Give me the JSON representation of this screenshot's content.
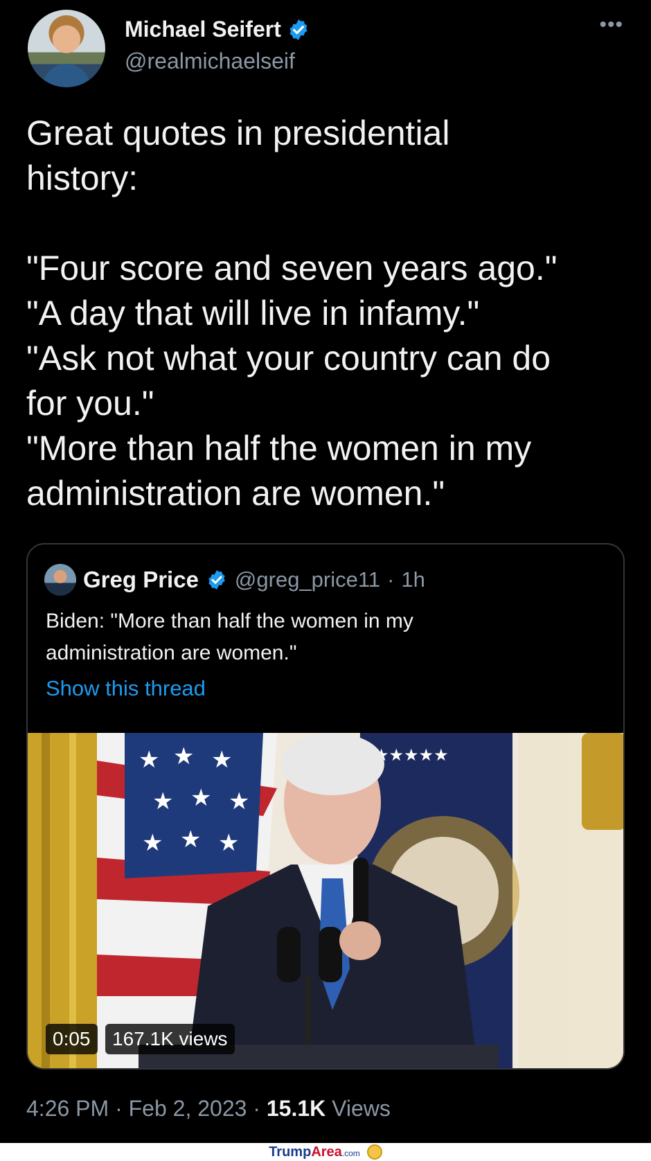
{
  "author": {
    "display_name": "Michael Seifert",
    "handle": "@realmichaelseif",
    "verified": true
  },
  "more_icon": "ellipsis-icon",
  "tweet": {
    "paragraph1": "Great quotes in presidential\nhistory:",
    "paragraph2": "\"Four score and seven years ago.\"\n\"A day that will live in infamy.\"\n\"Ask not what your country can do\nfor you.\"\n\"More than half the women in my\nadministration are women.\""
  },
  "quote": {
    "display_name": "Greg Price",
    "handle": "@greg_price11",
    "separator": "·",
    "time": "1h",
    "text": "Biden: \"More than half the women in my\nadministration are women.\"",
    "show_thread": "Show this thread",
    "video": {
      "duration": "0:05",
      "views": "167.1K views"
    }
  },
  "meta": {
    "time": "4:26 PM",
    "dot1": "·",
    "date": "Feb 2, 2023",
    "dot2": "·",
    "view_count": "15.1K",
    "views_label": "Views"
  },
  "footer": {
    "brand_part1": "Trump",
    "brand_part2": "Area",
    "brand_suffix": ".com"
  },
  "colors": {
    "background": "#000000",
    "text": "#e7e9ea",
    "secondary": "#8b98a5",
    "link": "#1d9bf0",
    "verified": "#1d9bf0"
  }
}
